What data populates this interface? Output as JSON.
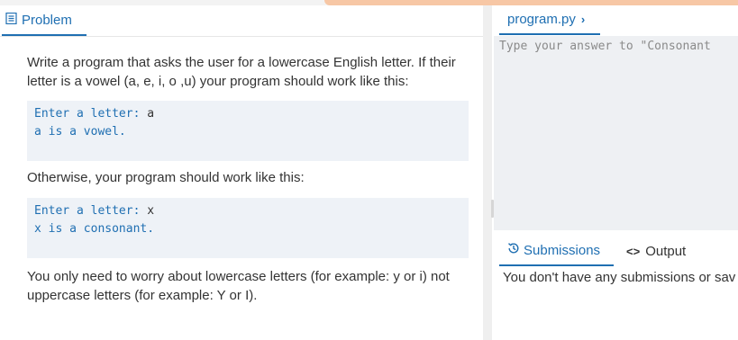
{
  "problem_tab": {
    "label": "Problem",
    "icon": "document-icon"
  },
  "problem": {
    "intro": "Write a program that asks the user for a lowercase English letter. If their letter is a vowel (a, e, i, o ,u) your program should work like this:",
    "example1": {
      "prompt": "Enter a letter:",
      "input": "a",
      "output": "a is a vowel."
    },
    "otherwise": "Otherwise, your program should work like this:",
    "example2": {
      "prompt": "Enter a letter:",
      "input": "x",
      "output": "x is a consonant."
    },
    "note": "You only need to worry about lowercase letters (for example: y or i) not uppercase letters (for example: Y or I)."
  },
  "editor": {
    "file_tab": "program.py",
    "placeholder": "Type your answer to \"Consonant"
  },
  "bottom_tabs": {
    "submissions": "Submissions",
    "output": "Output"
  },
  "submissions_message": "You don't have any submissions or sav",
  "colors": {
    "accent": "#1f6fb2",
    "top_accent": "#f7c7a5",
    "code_bg": "#eef2f7"
  }
}
